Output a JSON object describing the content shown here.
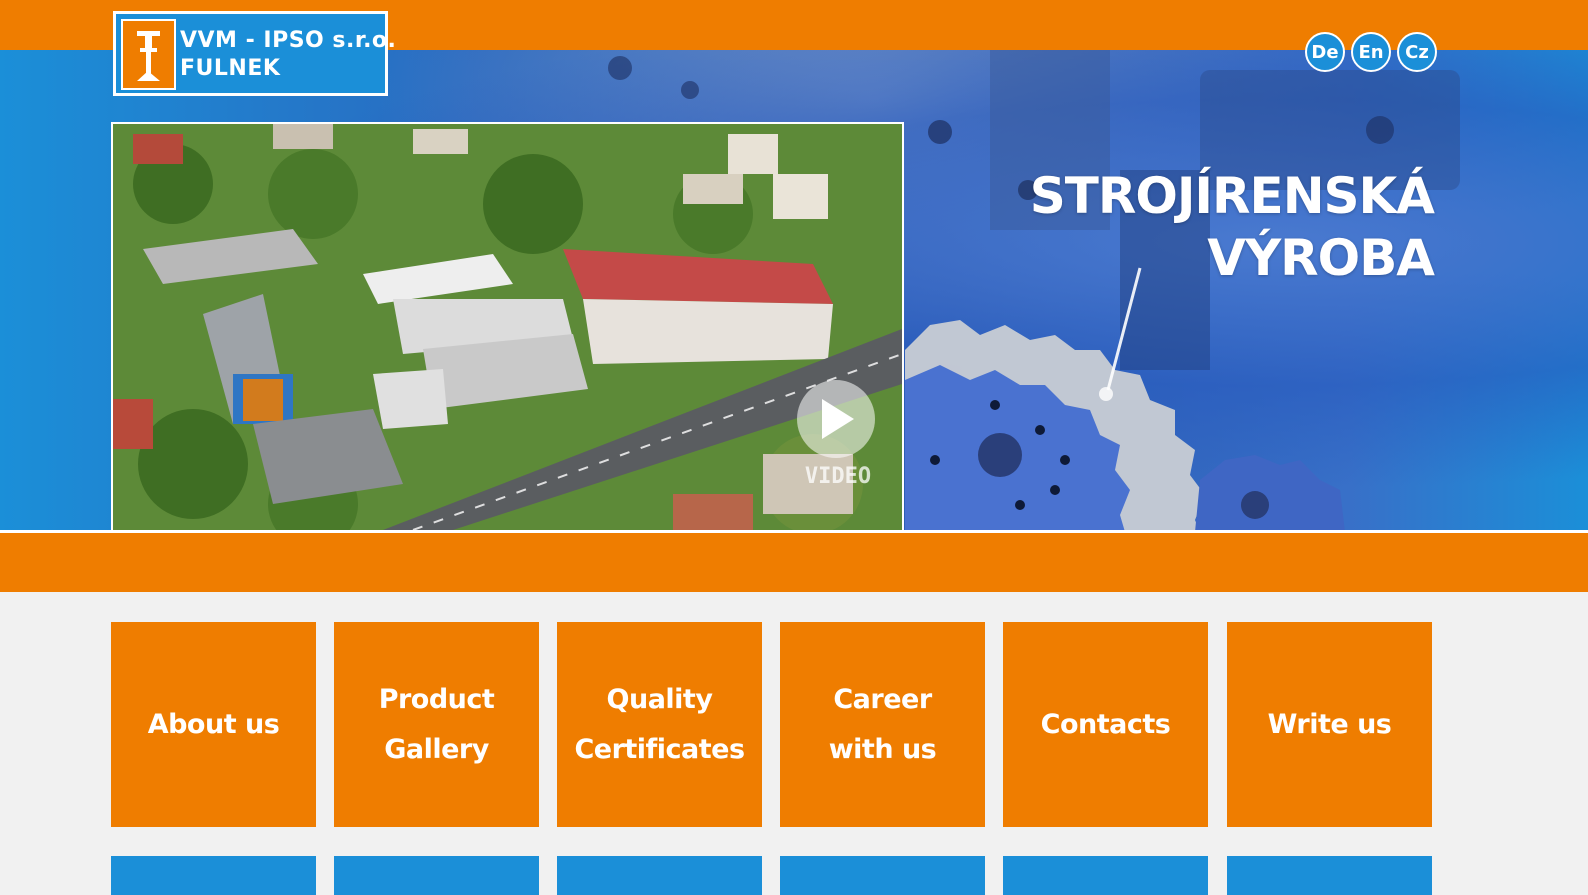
{
  "header": {
    "logo": {
      "line1": "VVM - IPSO s.r.o.",
      "line2": "FULNEK"
    },
    "languages": [
      {
        "label": "De"
      },
      {
        "label": "En"
      },
      {
        "label": "Cz"
      }
    ]
  },
  "hero": {
    "headline_line1": "STROJÍRENSKÁ",
    "headline_line2": "VÝROBA",
    "video_label": "VIDEO"
  },
  "nav_tiles": [
    {
      "line1": "About us",
      "line2": ""
    },
    {
      "line1": "Product",
      "line2": "Gallery"
    },
    {
      "line1": "Quality",
      "line2": "Certificates"
    },
    {
      "line1": "Career",
      "line2": "with us"
    },
    {
      "line1": "Contacts",
      "line2": ""
    },
    {
      "line1": "Write us",
      "line2": ""
    }
  ],
  "colors": {
    "brand_orange": "#ef7d00",
    "brand_blue": "#1b8fd8",
    "white": "#ffffff"
  },
  "icons": [
    "play-icon",
    "logo-icon"
  ]
}
